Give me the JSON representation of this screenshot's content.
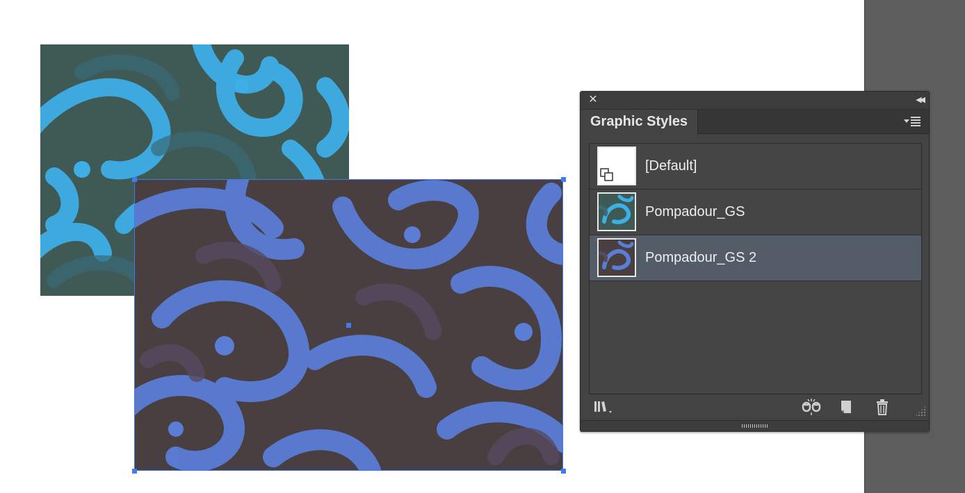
{
  "panel": {
    "title": "Graphic Styles",
    "close_icon": "close-icon",
    "collapse_icon": "collapse-arrows-icon",
    "menu_icon": "panel-menu-icon"
  },
  "styles": [
    {
      "label": "[Default]",
      "thumbnail": "default-style-thumbnail",
      "selected": false
    },
    {
      "label": "Pompadour_GS",
      "thumbnail": "pompadour-blue-thumbnail",
      "selected": false
    },
    {
      "label": "Pompadour_GS 2",
      "thumbnail": "pompadour-purple-thumbnail",
      "selected": true
    }
  ],
  "toolbar": {
    "libraries_icon": "graphic-styles-libraries-icon",
    "break_link_icon": "break-link-icon",
    "new_style_icon": "new-graphic-style-icon",
    "delete_icon": "trash-icon"
  },
  "colors": {
    "selection": "#3f7cf0",
    "blue_art_light": "#3eaee6",
    "blue_art_dark": "#3f5a55",
    "purple_art_light": "#5a7dd6",
    "purple_art_dark": "#4a3f40",
    "panel_bg": "#434343",
    "selected_row": "#535c67"
  }
}
